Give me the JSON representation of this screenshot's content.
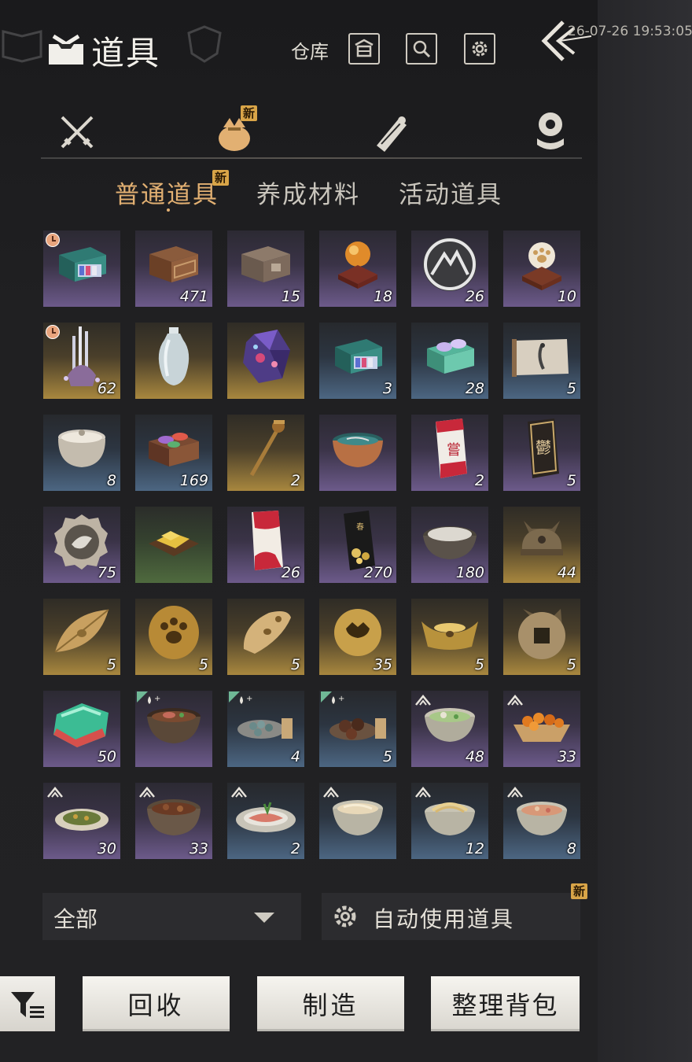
{
  "header": {
    "title": "道具",
    "warehouse_label": "仓库",
    "timestamp": "26-07-26 19:53:05"
  },
  "categories": [
    {
      "name": "weapons",
      "icon": "crossed-swords-icon",
      "active": false,
      "badge": ""
    },
    {
      "name": "items",
      "icon": "bundle-icon",
      "active": true,
      "badge": "新"
    },
    {
      "name": "scrolls",
      "icon": "scroll-icon",
      "active": false,
      "badge": ""
    },
    {
      "name": "tokens",
      "icon": "token-icon",
      "active": false,
      "badge": ""
    }
  ],
  "subtabs": {
    "common": "普通道具",
    "common_badge": "新",
    "materials": "养成材料",
    "event": "活动道具"
  },
  "items": [
    {
      "art": "cloth-box",
      "bg": "purple",
      "count": "",
      "clock": true
    },
    {
      "art": "carved-chest",
      "bg": "purple",
      "count": "471"
    },
    {
      "art": "wood-chest",
      "bg": "purple",
      "count": "15"
    },
    {
      "art": "orb-stand",
      "bg": "purple",
      "count": "18"
    },
    {
      "art": "mountain-coin",
      "bg": "purple",
      "count": "26"
    },
    {
      "art": "paw-orb",
      "bg": "purple",
      "count": "10"
    },
    {
      "art": "hairpin-stand",
      "bg": "gold",
      "count": "62",
      "clock": true
    },
    {
      "art": "vase",
      "bg": "gold",
      "count": ""
    },
    {
      "art": "crystal",
      "bg": "gold",
      "count": ""
    },
    {
      "art": "cloth-box",
      "bg": "blue",
      "count": "3"
    },
    {
      "art": "gift-box",
      "bg": "blue",
      "count": "28"
    },
    {
      "art": "scroll-painting",
      "bg": "blue",
      "count": "5"
    },
    {
      "art": "jar",
      "bg": "blue",
      "count": "8"
    },
    {
      "art": "dye-box",
      "bg": "blue",
      "count": "169"
    },
    {
      "art": "hairpin",
      "bg": "gold",
      "count": "2"
    },
    {
      "art": "bowl",
      "bg": "purple",
      "count": ""
    },
    {
      "art": "red-card",
      "bg": "purple",
      "count": "2"
    },
    {
      "art": "dark-card",
      "bg": "purple",
      "count": "5"
    },
    {
      "art": "bird-medal",
      "bg": "purple",
      "count": "75"
    },
    {
      "art": "gold-tray",
      "bg": "green",
      "count": ""
    },
    {
      "art": "red-envelope",
      "bg": "purple",
      "count": "26"
    },
    {
      "art": "black-card",
      "bg": "purple",
      "count": "270"
    },
    {
      "art": "flour-bowl",
      "bg": "purple",
      "count": "180"
    },
    {
      "art": "cat-bell",
      "bg": "gold",
      "count": "44"
    },
    {
      "art": "leaf",
      "bg": "gold",
      "count": "5"
    },
    {
      "art": "paw-walnut",
      "bg": "gold",
      "count": "5"
    },
    {
      "art": "fish-tag",
      "bg": "gold",
      "count": "5"
    },
    {
      "art": "gold-bell",
      "bg": "gold",
      "count": "35"
    },
    {
      "art": "ingot",
      "bg": "gold",
      "count": "5"
    },
    {
      "art": "cat-coin",
      "bg": "gold",
      "count": "5"
    },
    {
      "art": "jade",
      "bg": "purple",
      "count": "50"
    },
    {
      "art": "soup-bowl",
      "bg": "purple",
      "count": "",
      "drop": true
    },
    {
      "art": "beans-plate",
      "bg": "blue",
      "count": "4",
      "drop": true
    },
    {
      "art": "dumpling-plate",
      "bg": "blue",
      "count": "5",
      "drop": true
    },
    {
      "art": "green-soup",
      "bg": "purple",
      "count": "48",
      "up": true
    },
    {
      "art": "fruit-basket",
      "bg": "purple",
      "count": "33",
      "up": true
    },
    {
      "art": "herb-plate",
      "bg": "purple",
      "count": "30",
      "up": true
    },
    {
      "art": "stew-pot",
      "bg": "purple",
      "count": "33",
      "up": true
    },
    {
      "art": "fish-plate",
      "bg": "blue",
      "count": "2",
      "up": true
    },
    {
      "art": "noodle-bowl",
      "bg": "blue",
      "count": "",
      "up": true
    },
    {
      "art": "noodle-plate",
      "bg": "blue",
      "count": "12",
      "up": true
    },
    {
      "art": "porridge",
      "bg": "blue",
      "count": "8",
      "up": true
    }
  ],
  "bottom": {
    "filter_value": "全部",
    "auto_use_label": "自动使用道具",
    "auto_use_badge": "新",
    "recycle_label": "回收",
    "craft_label": "制造",
    "sort_label": "整理背包"
  },
  "colors": {
    "accent": "#e2b072",
    "badge": "#d9a548",
    "panel": "#1f1f22",
    "button": "#f1efea"
  }
}
